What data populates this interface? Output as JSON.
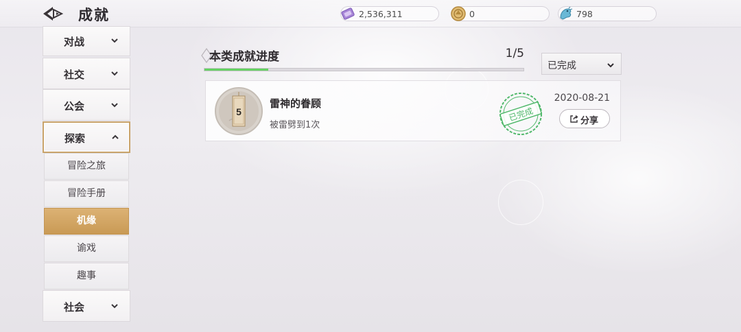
{
  "header": {
    "title": "成就",
    "back_icon": "back-arrow-icon",
    "currencies": [
      {
        "icon": "purple-ticket-icon",
        "value": "2,536,311"
      },
      {
        "icon": "gold-coin-icon",
        "value": "0"
      },
      {
        "icon": "blue-dragon-icon",
        "value": "798"
      }
    ]
  },
  "sidebar": {
    "items": [
      {
        "label": "对战",
        "expanded": false
      },
      {
        "label": "社交",
        "expanded": false
      },
      {
        "label": "公会",
        "expanded": false
      },
      {
        "label": "探索",
        "expanded": true
      },
      {
        "label": "社会",
        "expanded": false
      }
    ],
    "subitems": [
      {
        "label": "冒险之旅"
      },
      {
        "label": "冒险手册"
      },
      {
        "label": "机缘",
        "selected": true
      },
      {
        "label": "谕戏"
      },
      {
        "label": "趣事"
      }
    ]
  },
  "progress": {
    "title": "本类成就进度",
    "count": "1/5",
    "fraction": 0.2,
    "bar_color": "#66d163"
  },
  "filter": {
    "selected": "已完成"
  },
  "achievement": {
    "badge_number": "5",
    "name": "雷神的眷顾",
    "description": "被雷劈到1次",
    "stamp": "已完成",
    "date": "2020-08-21",
    "share_label": "分享"
  },
  "colors": {
    "accent_gold": "#c99a55",
    "stamp_green": "#4fb86a"
  }
}
